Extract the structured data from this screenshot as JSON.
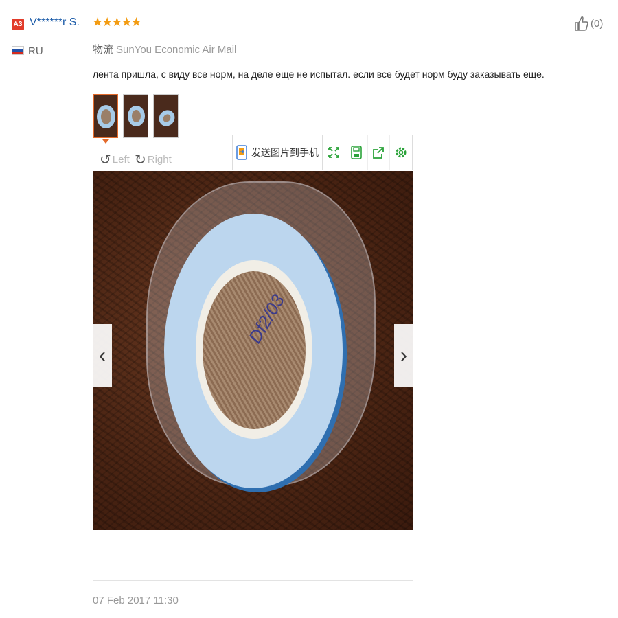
{
  "reviewer": {
    "badge": "A3",
    "name": "V******r S.",
    "stars": "★★★★★",
    "country_code": "RU",
    "flag_colors": [
      "#ffffff",
      "#2453a8",
      "#d52b1e"
    ]
  },
  "helpful": {
    "count": "(0)",
    "icon": "thumbs-up-icon"
  },
  "logistics": {
    "label": "物流",
    "value": "SunYou Economic Air Mail"
  },
  "review_text": "лента пришла, с виду все норм, на деле еще не испытал. если все будет норм буду заказывать еще.",
  "thumbnails_count": 3,
  "rotate": {
    "left_label": "Left",
    "right_label": "Right"
  },
  "toolbar": {
    "send_label": "发送图片到手机",
    "icons": [
      "expand-icon",
      "save-icon",
      "share-icon",
      "settings-icon"
    ]
  },
  "photo": {
    "handwriting": "Df2/03"
  },
  "nav": {
    "prev": "‹",
    "next": "›"
  },
  "date": "07 Feb 2017 11:30",
  "colors": {
    "accent": "#e36a2b",
    "name": "#1f5eaa",
    "stars": "#f39c12",
    "tool": "#2ba33a"
  }
}
